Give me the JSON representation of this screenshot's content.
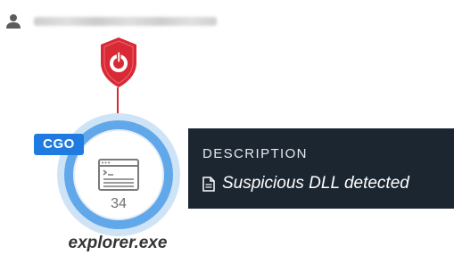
{
  "user": {
    "icon": "person-icon",
    "name_blurred": true
  },
  "detection": {
    "icon": "shield-alert-icon",
    "color": "#d82a35"
  },
  "process": {
    "name": "explorer.exe",
    "icon": "window-terminal-icon",
    "child_count": "34",
    "badge": "CGO",
    "badge_color": "#1f7be0",
    "ring_color": "#61a8ea"
  },
  "tooltip": {
    "heading": "DESCRIPTION",
    "icon": "document-icon",
    "text": "Suspicious DLL detected",
    "background": "#1c2631"
  }
}
